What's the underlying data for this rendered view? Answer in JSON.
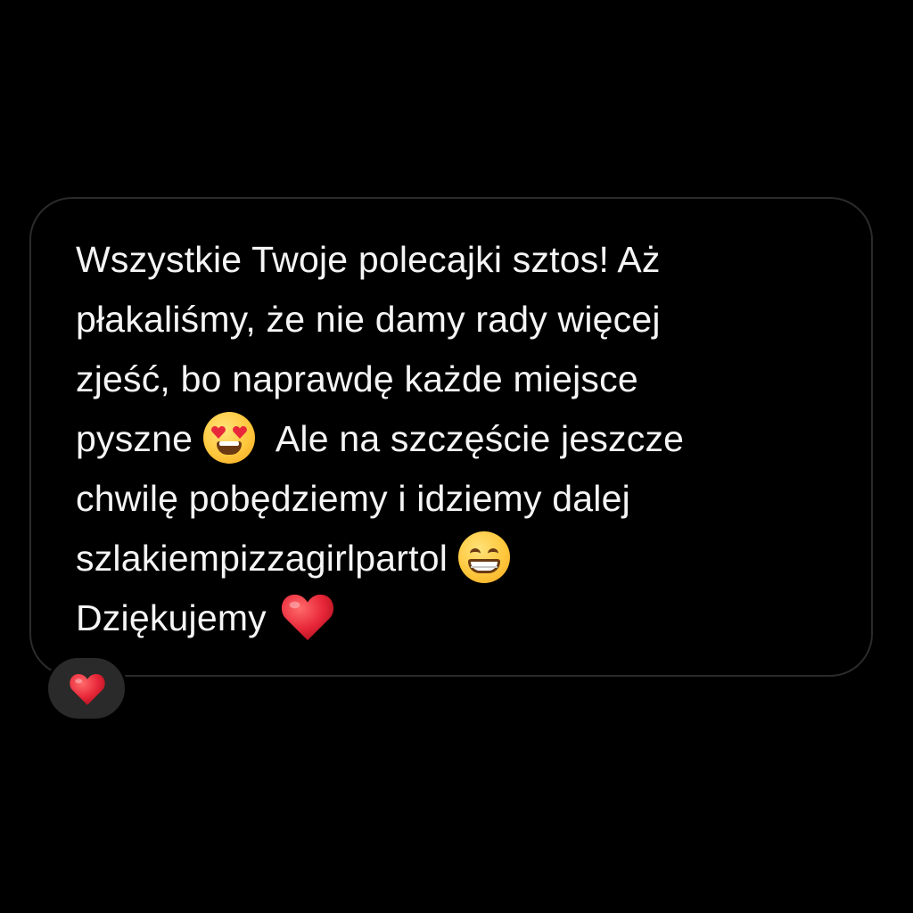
{
  "message": {
    "lines": [
      "Wszystkie Twoje polecajki sztos! Aż",
      "płakaliśmy, że nie damy rady więcej",
      "zjeść, bo naprawdę każde miejsce",
      "pyszne",
      "Ale na szczęście jeszcze",
      "chwilę pobędziemy i idziemy dalej",
      "szlakiempizzagirlpartol",
      "Dziękujemy"
    ],
    "emojis": [
      "heart-eyes-face",
      "grinning-face",
      "red-heart"
    ]
  },
  "reaction": {
    "emoji": "red-heart"
  },
  "colors": {
    "background": "#000000",
    "text": "#f5f5f5",
    "bubble_border": "#2b2b2b",
    "reaction_bg": "#2a2a2a",
    "heart": "#e8283a"
  }
}
